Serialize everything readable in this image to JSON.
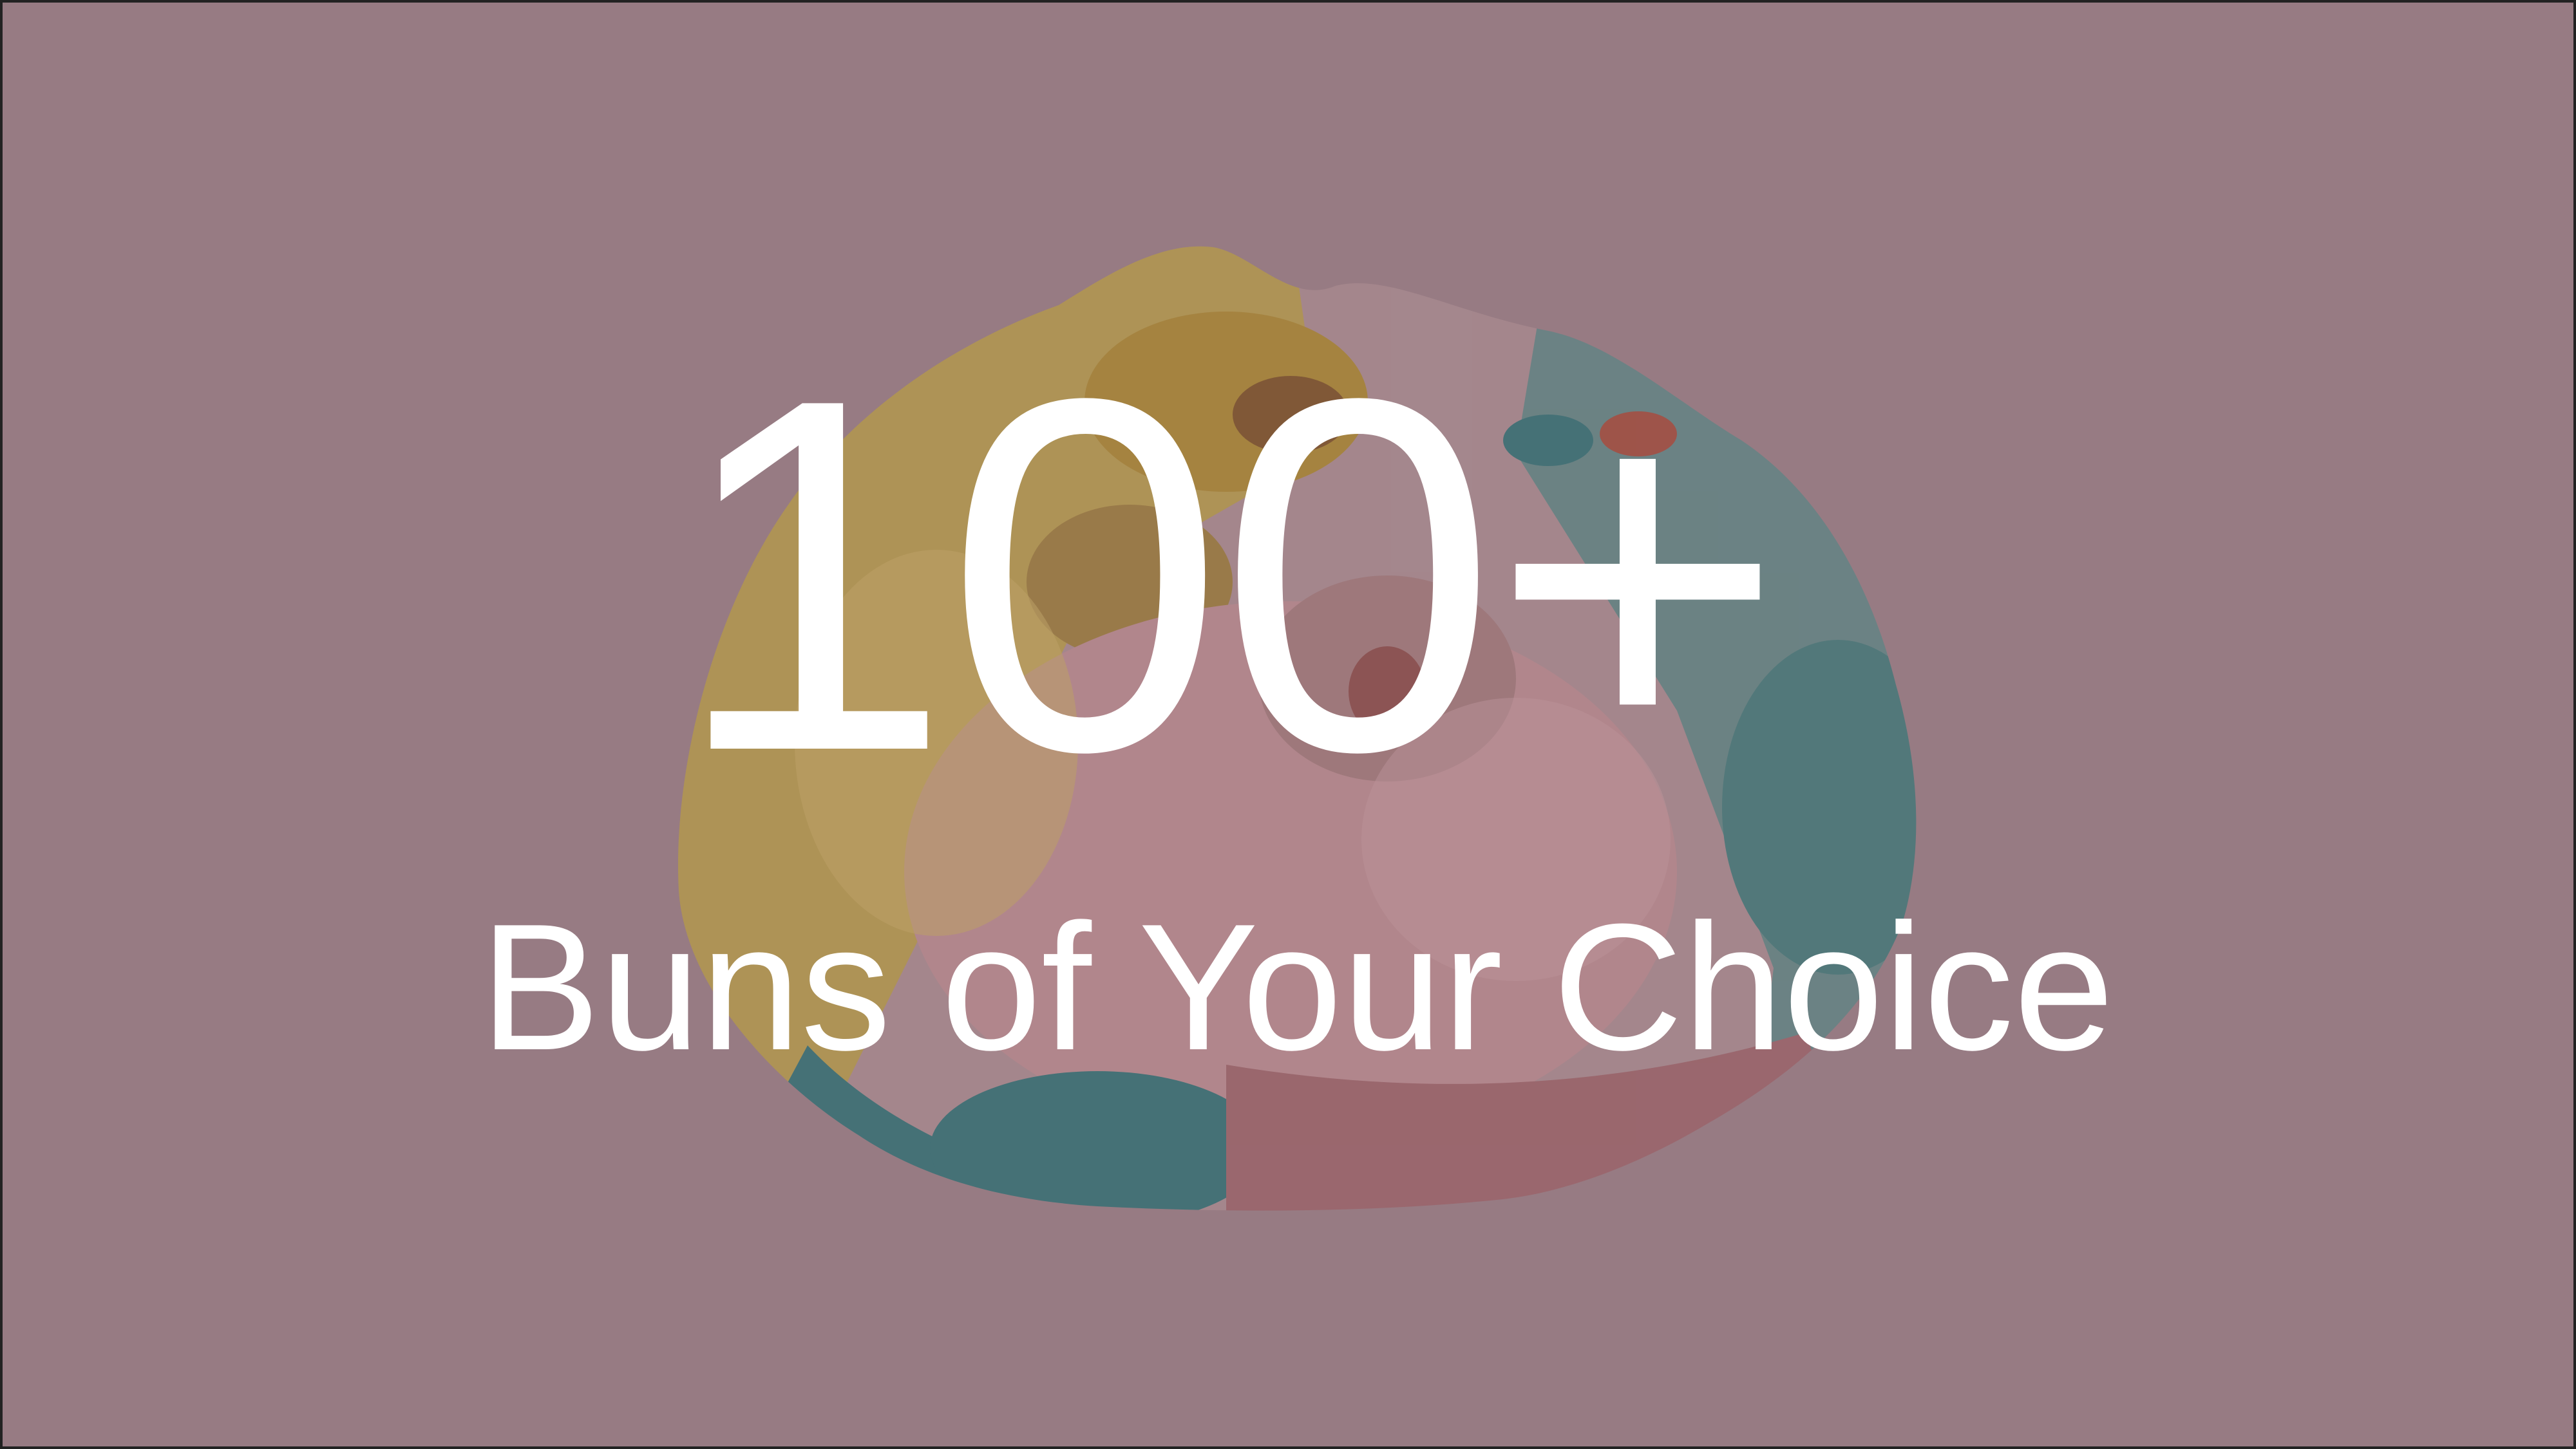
{
  "slide": {
    "headline": "100+",
    "subtitle": "Buns of Your Choice"
  },
  "colors": {
    "background": "#977b83",
    "text": "#ffffff",
    "bun_yellow": "#b59a4a",
    "bun_teal": "#2f6f73",
    "bun_pink": "#b98a8f"
  },
  "icons": {
    "bun_illustration": "steamed-bun-icon"
  }
}
